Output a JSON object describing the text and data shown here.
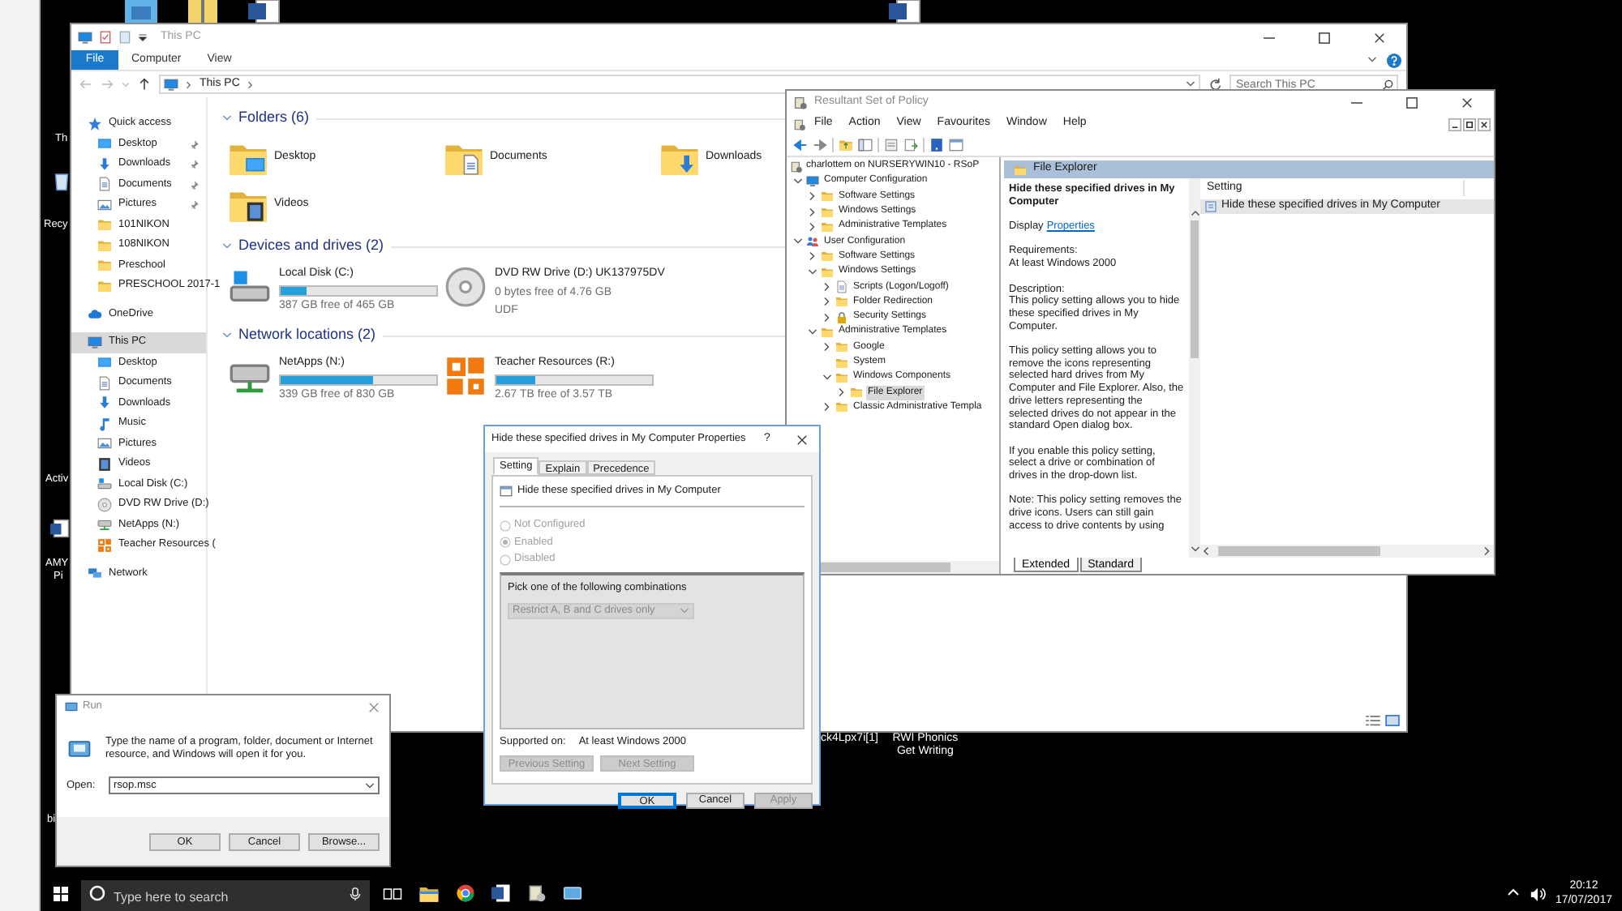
{
  "desktop": {
    "edge_labels": [
      "Th",
      "Recy",
      "Activ",
      "AMY",
      "Pi",
      "bi"
    ],
    "labels": [
      "ck4Lpx7i[1]",
      "RWI Phonics Get Writing"
    ]
  },
  "explorer": {
    "title": "This PC",
    "ribbon_tabs": [
      {
        "label": "File",
        "kind": "menu"
      },
      {
        "label": "Computer",
        "kind": "tab"
      },
      {
        "label": "View",
        "kind": "tab"
      }
    ],
    "address_path": "This PC",
    "search": {
      "placeholder": "Search This PC"
    },
    "nav": [
      {
        "label": "Quick access",
        "kind": "star",
        "selected": false,
        "children": [
          {
            "label": "Desktop",
            "kind": "desktop",
            "pinned": true,
            "selected": false
          },
          {
            "label": "Downloads",
            "kind": "download",
            "pinned": true,
            "selected": false
          },
          {
            "label": "Documents",
            "kind": "document",
            "pinned": true,
            "selected": false
          },
          {
            "label": "Pictures",
            "kind": "picture",
            "pinned": true,
            "selected": false
          },
          {
            "label": "101NIKON",
            "kind": "folder",
            "pinned": false,
            "selected": false
          },
          {
            "label": "108NIKON",
            "kind": "folder",
            "pinned": false,
            "selected": false
          },
          {
            "label": "Preschool",
            "kind": "folder",
            "pinned": false,
            "selected": false
          },
          {
            "label": "PRESCHOOL 2017-1",
            "kind": "folder",
            "pinned": false,
            "selected": false
          }
        ]
      },
      {
        "label": "OneDrive",
        "kind": "cloud",
        "selected": false
      },
      {
        "label": "This PC",
        "kind": "pc",
        "selected": true,
        "children": [
          {
            "label": "Desktop",
            "kind": "desktop",
            "selected": false
          },
          {
            "label": "Documents",
            "kind": "document",
            "selected": false
          },
          {
            "label": "Downloads",
            "kind": "download",
            "selected": false
          },
          {
            "label": "Music",
            "kind": "music",
            "selected": false
          },
          {
            "label": "Pictures",
            "kind": "picture",
            "selected": false
          },
          {
            "label": "Videos",
            "kind": "video",
            "selected": false
          },
          {
            "label": "Local Disk (C:)",
            "kind": "disk",
            "selected": false
          },
          {
            "label": "DVD RW Drive (D:)",
            "kind": "dvd",
            "selected": false
          },
          {
            "label": "NetApps (N:)",
            "kind": "netdrive",
            "selected": false
          },
          {
            "label": "Teacher Resources (",
            "kind": "share",
            "selected": false
          }
        ]
      },
      {
        "label": "Network",
        "kind": "network",
        "selected": false
      }
    ],
    "sections": [
      {
        "title": "Folders (6)",
        "expanded": true,
        "items": [
          {
            "name": "Desktop",
            "kind": "desktop"
          },
          {
            "name": "Documents",
            "kind": "document"
          },
          {
            "name": "Downloads",
            "kind": "download"
          },
          {
            "name": "Videos",
            "kind": "video"
          }
        ]
      },
      {
        "title": "Devices and drives (2)",
        "expanded": true,
        "items": [
          {
            "name": "Local Disk (C:)",
            "kind": "disk",
            "level": 0.17,
            "detail": "387 GB free of 465 GB"
          },
          {
            "name": "DVD RW Drive (D:) UK137975DV",
            "kind": "dvd",
            "detail": "0 bytes free of 4.76 GB",
            "file_system": "UDF"
          }
        ]
      },
      {
        "title": "Network locations (2)",
        "expanded": true,
        "items": [
          {
            "name": "NetApps (N:)",
            "kind": "netdrive",
            "level": 0.59,
            "detail": "339 GB free of 830 GB"
          },
          {
            "name": "Teacher Resources (R:)",
            "kind": "share",
            "level": 0.25,
            "detail": "2.67 TB free of 3.57 TB"
          }
        ]
      }
    ]
  },
  "rsop": {
    "title": "Resultant Set of Policy",
    "menu": [
      "File",
      "Action",
      "View",
      "Favourites",
      "Window",
      "Help"
    ],
    "tree": {
      "root": {
        "label": "charlottem on NURSERYWIN10 - RSoP"
      },
      "items": [
        {
          "label": "Computer Configuration",
          "kind": "computer",
          "expanded": true,
          "selected": false,
          "children": [
            {
              "label": "Software Settings",
              "kind": "folder",
              "expanded": false,
              "selected": false
            },
            {
              "label": "Windows Settings",
              "kind": "folder",
              "expanded": false,
              "selected": false
            },
            {
              "label": "Administrative Templates",
              "kind": "folder",
              "expanded": false,
              "selected": false
            }
          ]
        },
        {
          "label": "User Configuration",
          "kind": "user",
          "expanded": true,
          "selected": false,
          "children": [
            {
              "label": "Software Settings",
              "kind": "folder",
              "expanded": false,
              "selected": false
            },
            {
              "label": "Windows Settings",
              "kind": "folder",
              "expanded": true,
              "selected": false,
              "children": [
                {
                  "label": "Scripts (Logon/Logoff)",
                  "kind": "script",
                  "expanded": false,
                  "selected": false
                },
                {
                  "label": "Folder Redirection",
                  "kind": "folder",
                  "expanded": false,
                  "selected": false
                },
                {
                  "label": "Security Settings",
                  "kind": "security",
                  "expanded": false,
                  "selected": false
                }
              ]
            },
            {
              "label": "Administrative Templates",
              "kind": "folder",
              "expanded": true,
              "selected": false,
              "children": [
                {
                  "label": "Google",
                  "kind": "folder",
                  "expanded": false,
                  "selected": false
                },
                {
                  "label": "System",
                  "kind": "folder",
                  "selected": false
                },
                {
                  "label": "Windows Components",
                  "kind": "folder",
                  "expanded": true,
                  "selected": false,
                  "children": [
                    {
                      "label": "File Explorer",
                      "kind": "folder",
                      "expanded": false,
                      "selected": true
                    }
                  ]
                },
                {
                  "label": "Classic Administrative Templa",
                  "kind": "folder",
                  "expanded": false,
                  "selected": false
                }
              ]
            }
          ]
        }
      ]
    },
    "pane_header": "File Explorer",
    "policy": {
      "title": "Hide these specified drives in My Computer",
      "display_label": "Display",
      "display_link": "Properties",
      "requirements_label": "Requirements:",
      "requirements": "At least Windows 2000",
      "description_label": "Description:",
      "paragraphs": [
        "This policy setting allows you to hide these specified drives in My Computer.",
        "This policy setting allows you to remove the icons representing selected hard drives from My Computer and File Explorer. Also, the drive letters representing the selected drives do not appear in the standard Open dialog box.",
        "If you enable this policy setting, select a drive or combination of drives in the drop-down list.",
        "Note: This policy setting removes the drive icons. Users can still gain access to drive contents by using"
      ]
    },
    "list": {
      "columns": [
        "Setting"
      ],
      "rows": [
        {
          "setting": "Hide these specified drives in My Computer",
          "selected": true
        }
      ]
    },
    "view_tabs": [
      {
        "label": "Extended",
        "selected": true
      },
      {
        "label": "Standard",
        "selected": false
      }
    ]
  },
  "properties": {
    "title": "Hide these specified drives in My Computer Properties",
    "help": "?",
    "tabs": [
      {
        "label": "Setting",
        "selected": true
      },
      {
        "label": "Explain",
        "selected": false
      },
      {
        "label": "Precedence",
        "selected": false
      }
    ],
    "policy_name": "Hide these specified drives in My Computer",
    "options": [
      {
        "label": "Not Configured",
        "checked": false,
        "disabled": true
      },
      {
        "label": "Enabled",
        "checked": true,
        "disabled": true
      },
      {
        "label": "Disabled",
        "checked": false,
        "disabled": true
      }
    ],
    "group_label": "Pick one of the following combinations",
    "combo": {
      "value": "Restrict A, B and C drives only",
      "disabled": true
    },
    "supported_label": "Supported on:",
    "supported": "At least Windows 2000",
    "nav_buttons": [
      {
        "label": "Previous Setting",
        "disabled": true
      },
      {
        "label": "Next Setting",
        "disabled": true
      }
    ],
    "buttons": [
      {
        "label": "OK",
        "kind": "default",
        "disabled": false
      },
      {
        "label": "Cancel",
        "kind": "normal",
        "disabled": false
      },
      {
        "label": "Apply",
        "kind": "normal",
        "disabled": true
      }
    ]
  },
  "run": {
    "title": "Run",
    "prompt": "Type the name of a program, folder, document or Internet resource, and Windows will open it for you.",
    "open_label": "Open:",
    "open_value": "rsop.msc",
    "buttons": [
      "OK",
      "Cancel",
      "Browse..."
    ]
  },
  "taskbar": {
    "search_placeholder": "Type here to search",
    "time": "20:12",
    "date": "17/07/2017"
  }
}
